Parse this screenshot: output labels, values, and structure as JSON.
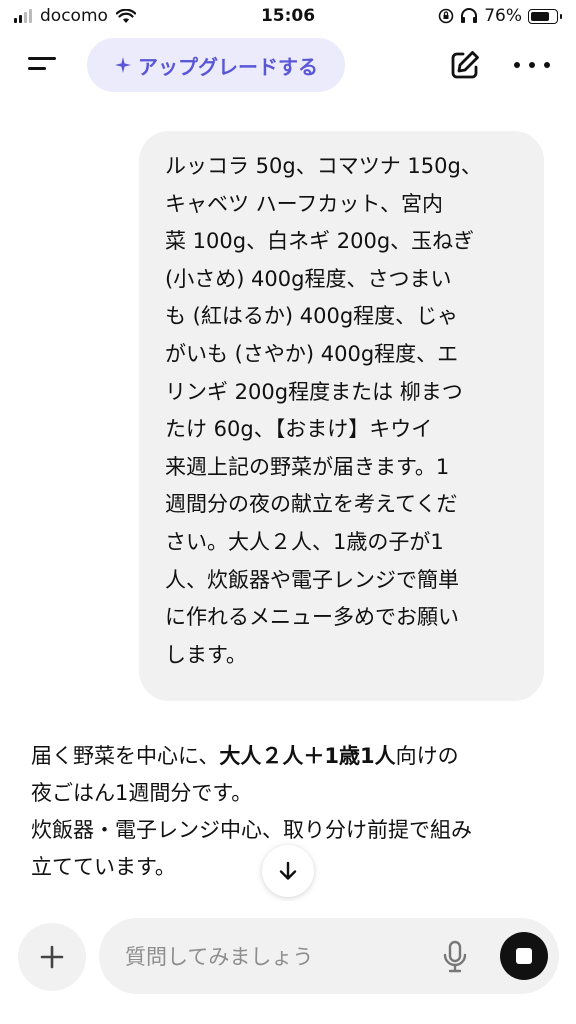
{
  "status_bar": {
    "carrier": "docomo",
    "time": "15:06",
    "battery": "76%",
    "battery_level": 0.76
  },
  "header": {
    "upgrade_label": "アップグレードする",
    "upgrade_icon": "sparkle-icon",
    "menu_icon": "menu-icon",
    "new_chat_icon": "edit-icon",
    "more_icon": "more-icon"
  },
  "user_message": {
    "lines": [
      "ルッコラ 50g、コマツナ 150g、",
      "キャベツ ハーフカット、宮内",
      "菜 100g、白ネギ 200g、玉ねぎ",
      "(小さめ) 400g程度、さつまい",
      "も (紅はるか) 400g程度、じゃ",
      "がいも (さやか) 400g程度、エ",
      "リンギ 200g程度または 柳まつ",
      "たけ 60g、【おまけ】キウイ",
      "来週上記の野菜が届きます。1",
      "週間分の夜の献立を考えてくだ",
      "さい。大人２人、1歳の子が1",
      "人、炊飯器や電子レンジで簡単",
      "に作れるメニュー多めでお願い",
      "します。"
    ]
  },
  "assistant_message": {
    "line1_prefix": "届く野菜を中心に、",
    "line1_bold": "大人２人＋1歳1人",
    "line1_suffix": "向けの",
    "line2": "夜ごはん1週間分です。",
    "line3": "炊飯器・電子レンジ中心、取り分け前提で組み",
    "line4": "立てています。"
  },
  "composer": {
    "placeholder": "質問してみましょう",
    "plus_icon": "plus-icon",
    "mic_icon": "microphone-icon",
    "stop_icon": "stop-icon",
    "scroll_icon": "arrow-down-icon"
  },
  "colors": {
    "accent": "#5a57d6",
    "upgrade_bg": "#ecebfb",
    "bubble_bg": "#f1f1f1"
  }
}
